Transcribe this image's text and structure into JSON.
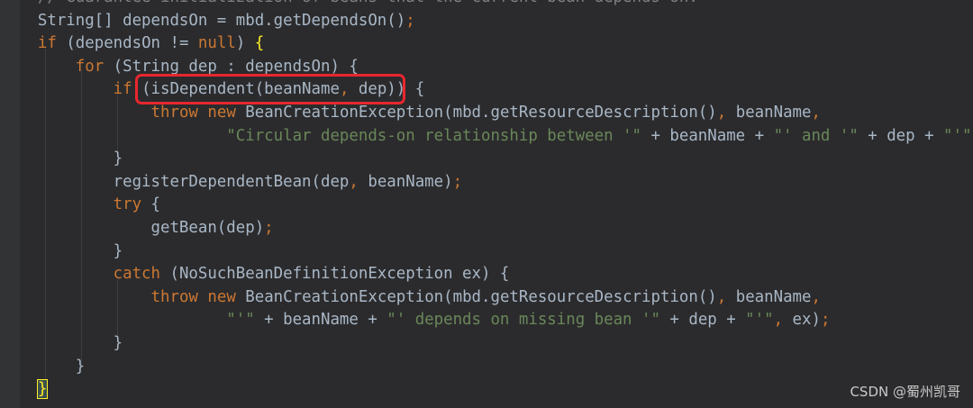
{
  "code_lines": [
    "    // Guarantee initialization of beans that the current bean depends on.",
    "    String[] dependsOn = mbd.getDependsOn();",
    "    if (dependsOn != null) {",
    "        for (String dep : dependsOn) {",
    "            if (isDependent(beanName, dep)) {",
    "                throw new BeanCreationException(mbd.getResourceDescription(), beanName,",
    "                        \"Circular depends-on relationship between '\" + beanName + \"' and '\" + dep + \"'\");",
    "            }",
    "            registerDependentBean(dep, beanName);",
    "            try {",
    "                getBean(dep);",
    "            }",
    "            catch (NoSuchBeanDefinitionException ex) {",
    "                throw new BeanCreationException(mbd.getResourceDescription(), beanName,",
    "                        \"'\" + beanName + \"' depends on missing bean '\" + dep + \"'\", ex);",
    "            }",
    "        }",
    "    }"
  ],
  "watermark": "CSDN @蜀州凯哥",
  "colors": {
    "background": "#2b2b2d",
    "text": "#a9b7c6",
    "keyword": "#cc7832",
    "string": "#6a8759",
    "comment": "#808080",
    "highlight_box": "#e8262e",
    "brace_match": "#ffef28"
  }
}
